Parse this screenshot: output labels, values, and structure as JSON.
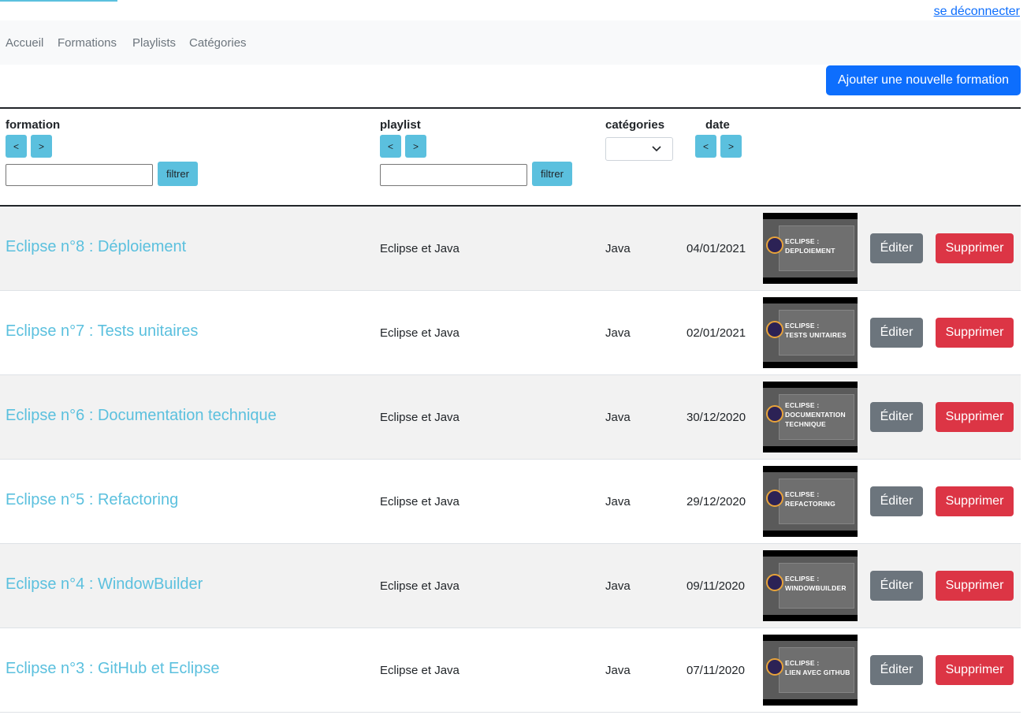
{
  "header": {
    "logout_label": "se déconnecter"
  },
  "nav": {
    "items": [
      "Accueil",
      "Formations",
      "Playlists",
      "Catégories"
    ]
  },
  "actions": {
    "add_label": "Ajouter une nouvelle formation"
  },
  "table": {
    "columns": {
      "formation": "formation",
      "playlist": "playlist",
      "categories": "catégories",
      "date": "date"
    },
    "sort_asc": "<",
    "sort_desc": ">",
    "filter_label": "filtrer",
    "category_selected": "",
    "edit_label": "Éditer",
    "delete_label": "Supprimer",
    "rows": [
      {
        "title": "Eclipse n°8 : Déploiement",
        "playlist": "Eclipse et Java",
        "category": "Java",
        "date": "04/01/2021",
        "thumb_line1": "ECLIPSE :",
        "thumb_line2": "DEPLOIEMENT",
        "thumb_line3": ""
      },
      {
        "title": "Eclipse n°7 : Tests unitaires",
        "playlist": "Eclipse et Java",
        "category": "Java",
        "date": "02/01/2021",
        "thumb_line1": "ECLIPSE :",
        "thumb_line2": "TESTS UNITAIRES",
        "thumb_line3": ""
      },
      {
        "title": "Eclipse n°6 : Documentation technique",
        "playlist": "Eclipse et Java",
        "category": "Java",
        "date": "30/12/2020",
        "thumb_line1": "ECLIPSE :",
        "thumb_line2": "DOCUMENTATION",
        "thumb_line3": "TECHNIQUE"
      },
      {
        "title": "Eclipse n°5 : Refactoring",
        "playlist": "Eclipse et Java",
        "category": "Java",
        "date": "29/12/2020",
        "thumb_line1": "ECLIPSE :",
        "thumb_line2": "REFACTORING",
        "thumb_line3": ""
      },
      {
        "title": "Eclipse n°4 : WindowBuilder",
        "playlist": "Eclipse et Java",
        "category": "Java",
        "date": "09/11/2020",
        "thumb_line1": "ECLIPSE :",
        "thumb_line2": "WINDOWBUILDER",
        "thumb_line3": ""
      },
      {
        "title": "Eclipse n°3 : GitHub et Eclipse",
        "playlist": "Eclipse et Java",
        "category": "Java",
        "date": "07/11/2020",
        "thumb_line1": "ECLIPSE :",
        "thumb_line2": "LIEN AVEC GITHUB",
        "thumb_line3": ""
      }
    ]
  }
}
